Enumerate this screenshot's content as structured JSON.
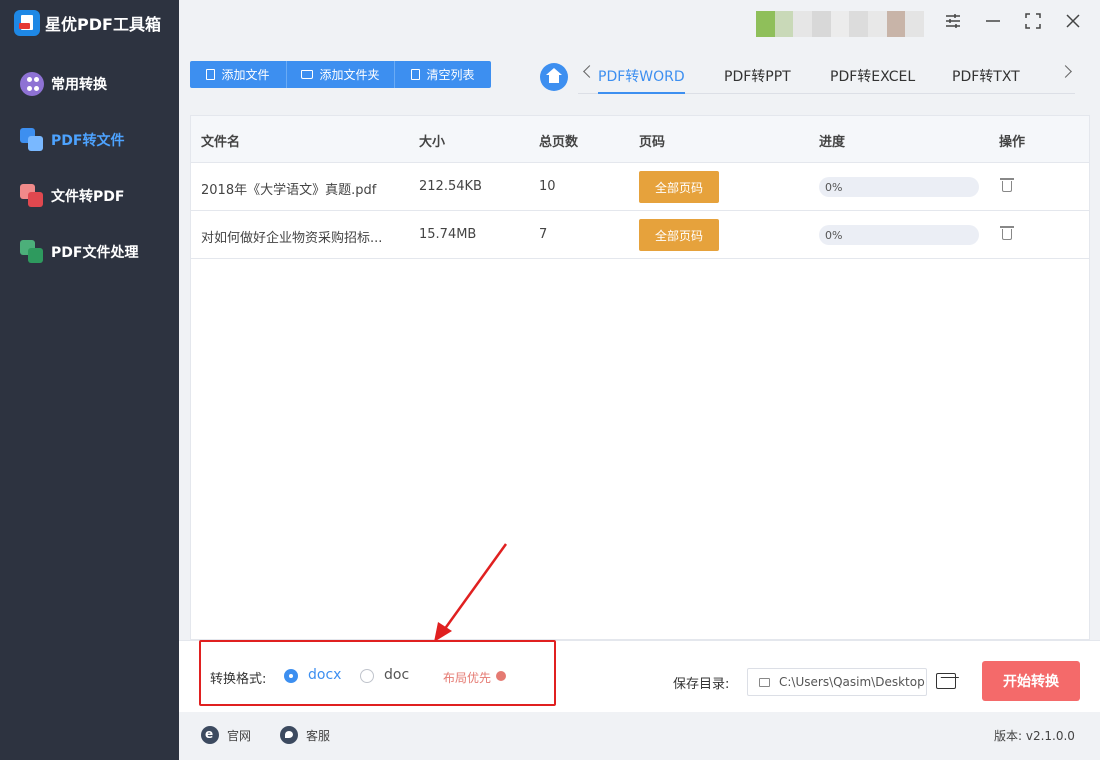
{
  "app": {
    "title": "星优PDF工具箱"
  },
  "sidebar": {
    "items": [
      {
        "label": "常用转换",
        "icon": "grid-dots-icon",
        "active": false
      },
      {
        "label": "PDF转文件",
        "icon": "pdf-to-file-icon",
        "active": true
      },
      {
        "label": "文件转PDF",
        "icon": "file-to-pdf-icon",
        "active": false
      },
      {
        "label": "PDF文件处理",
        "icon": "pdf-process-icon",
        "active": false
      }
    ]
  },
  "toolbar": {
    "add_file": "添加文件",
    "add_folder": "添加文件夹",
    "clear_list": "清空列表"
  },
  "tabs": [
    {
      "label": "PDF转WORD",
      "active": true
    },
    {
      "label": "PDF转PPT",
      "active": false
    },
    {
      "label": "PDF转EXCEL",
      "active": false
    },
    {
      "label": "PDF转TXT",
      "active": false
    }
  ],
  "table": {
    "headers": {
      "filename": "文件名",
      "size": "大小",
      "pages": "总页数",
      "page_range": "页码",
      "progress": "进度",
      "actions": "操作"
    },
    "rows": [
      {
        "filename": "2018年《大学语文》真题.pdf",
        "size": "212.54KB",
        "pages": "10",
        "page_range": "全部页码",
        "progress_text": "0%",
        "progress": 0
      },
      {
        "filename": "对如何做好企业物资采购招标...",
        "size": "15.74MB",
        "pages": "7",
        "page_range": "全部页码",
        "progress_text": "0%",
        "progress": 0
      }
    ]
  },
  "format": {
    "label": "转换格式:",
    "options": [
      {
        "label": "docx",
        "selected": true
      },
      {
        "label": "doc",
        "selected": false
      }
    ],
    "hint": "布局优先"
  },
  "save": {
    "label": "保存目录:",
    "path": "C:\\Users\\Qasim\\Desktop"
  },
  "start_button": "开始转换",
  "footer": {
    "website": "官网",
    "support": "客服",
    "version": "版本: v2.1.0.0"
  },
  "colors": {
    "accent": "#3d8ff0",
    "sidebar_bg": "#2d3340",
    "page_btn": "#e6a23c",
    "start_btn": "#f46a6a",
    "annotation": "#e02020"
  }
}
